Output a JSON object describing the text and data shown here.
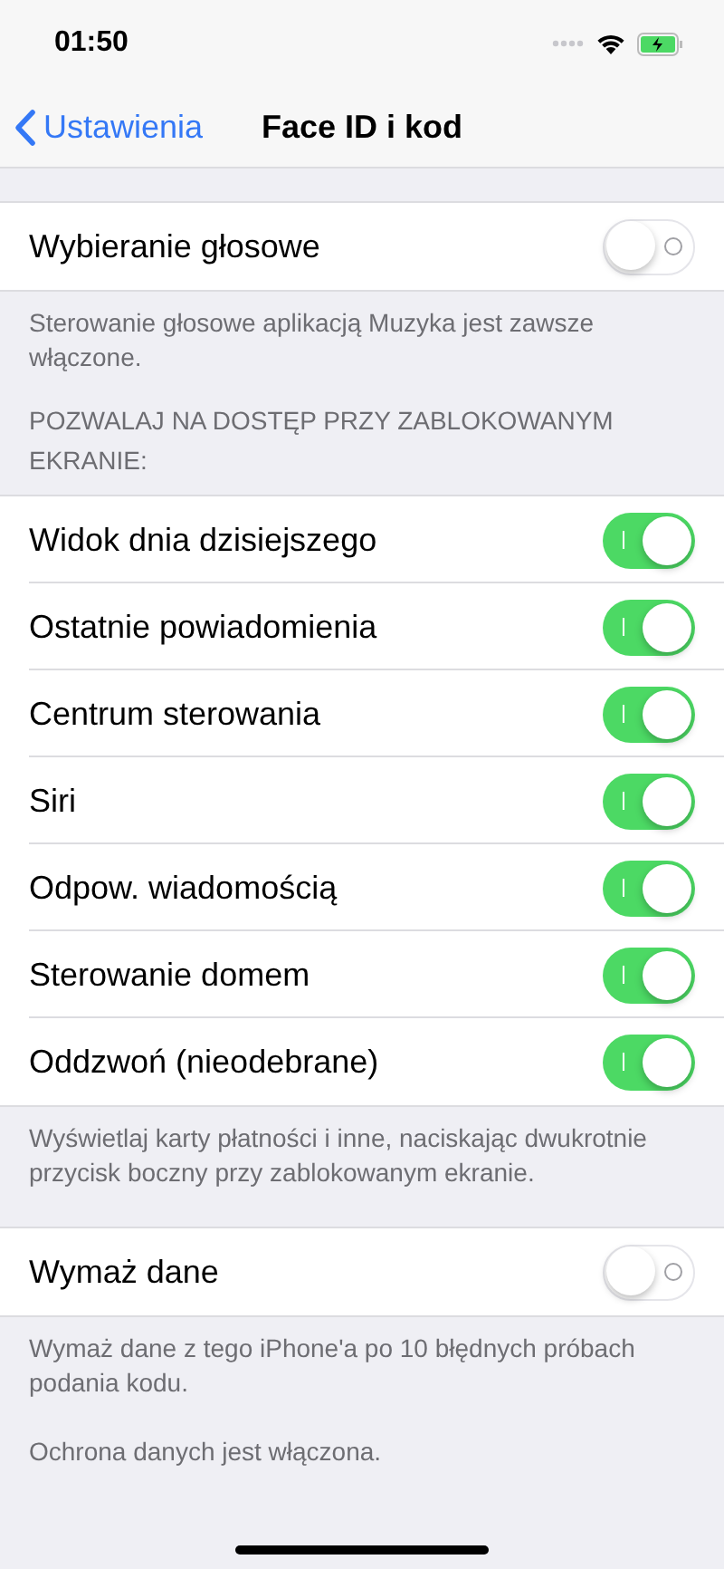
{
  "status_bar": {
    "time": "01:50"
  },
  "nav": {
    "back": "Ustawienia",
    "title": "Face ID i kod"
  },
  "sections": [
    {
      "rows": [
        {
          "label": "Wybieranie głosowe",
          "on": false
        }
      ],
      "footer": [
        "Sterowanie głosowe aplikacją Muzyka jest zawsze włączone."
      ]
    },
    {
      "header": "POZWALAJ NA DOSTĘP PRZY ZABLOKOWANYM EKRANIE:",
      "rows": [
        {
          "label": "Widok dnia dzisiejszego",
          "on": true
        },
        {
          "label": "Ostatnie powiadomienia",
          "on": true
        },
        {
          "label": "Centrum sterowania",
          "on": true
        },
        {
          "label": "Siri",
          "on": true
        },
        {
          "label": "Odpow. wiadomością",
          "on": true
        },
        {
          "label": "Sterowanie domem",
          "on": true
        },
        {
          "label": "Oddzwoń (nieodebrane)",
          "on": true
        }
      ],
      "footer": [
        "Wyświetlaj karty płatności i inne, naciskając dwukrotnie przycisk boczny przy zablokowanym ekranie."
      ]
    },
    {
      "rows": [
        {
          "label": "Wymaż dane",
          "on": false
        }
      ],
      "footer": [
        "Wymaż dane z tego iPhone'a po 10 błędnych próbach podania kodu.",
        "Ochrona danych jest włączona."
      ]
    }
  ]
}
